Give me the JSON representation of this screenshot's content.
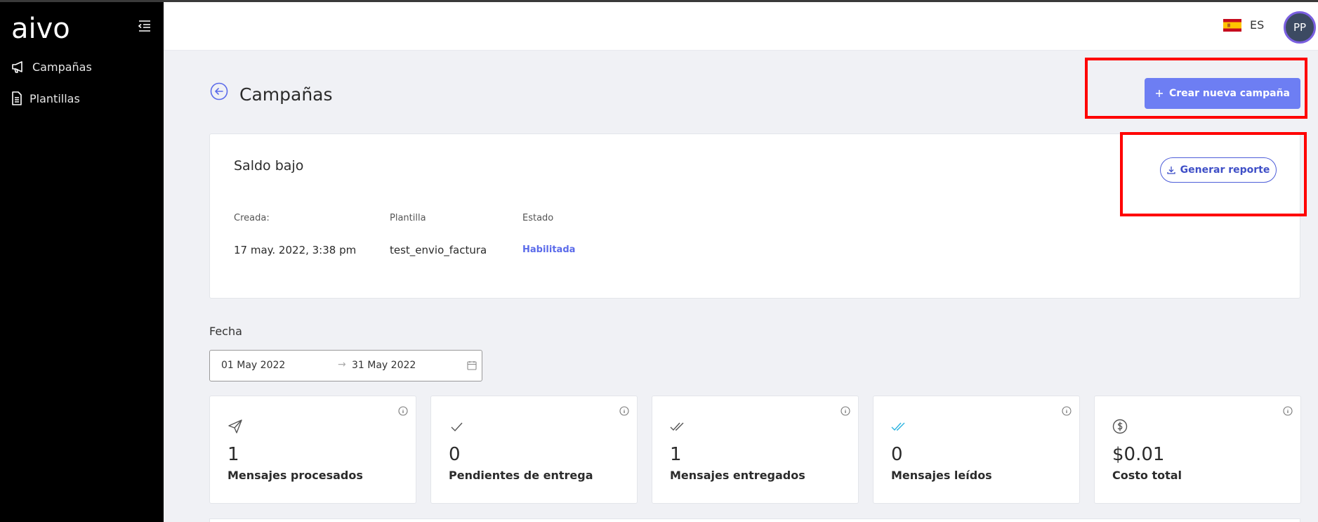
{
  "sidebar": {
    "logo_text": "aivo",
    "items": [
      {
        "label": "Campañas",
        "icon": "megaphone-icon"
      },
      {
        "label": "Plantillas",
        "icon": "document-icon"
      }
    ]
  },
  "header": {
    "language": "ES",
    "avatar_initials": "PP"
  },
  "page": {
    "title": "Campañas",
    "create_button": "Crear nueva campaña"
  },
  "campaign": {
    "name": "Saldo bajo",
    "report_button": "Generar reporte",
    "fields": [
      {
        "label": "Creada:",
        "value": "17 may. 2022, 3:38 pm"
      },
      {
        "label": "Plantilla",
        "value": "test_envio_factura"
      },
      {
        "label": "Estado",
        "value": "Habilitada"
      }
    ]
  },
  "date_filter": {
    "label": "Fecha",
    "from": "01 May 2022",
    "to": "31 May 2022"
  },
  "stats": [
    {
      "value": "1",
      "label": "Mensajes procesados",
      "icon": "send-icon"
    },
    {
      "value": "0",
      "label": "Pendientes de entrega",
      "icon": "check-icon"
    },
    {
      "value": "1",
      "label": "Mensajes entregados",
      "icon": "double-check-icon"
    },
    {
      "value": "0",
      "label": "Mensajes leídos",
      "icon": "double-check-read-icon"
    },
    {
      "value": "$0.01",
      "label": "Costo total",
      "icon": "dollar-icon"
    }
  ],
  "colors": {
    "primary": "#6d7ef3",
    "status_enabled": "#5b6bea",
    "read_check": "#2bb3e0",
    "highlight": "#ff0000"
  }
}
